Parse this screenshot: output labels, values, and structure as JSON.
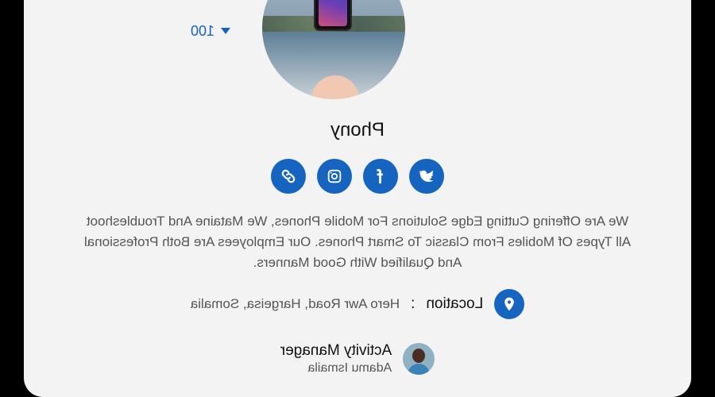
{
  "profile": {
    "score": "100",
    "name": "Phony",
    "description": "We Are Offering Cutting Edge Solutions For Mobile Phones, We Mataine And Troubleshoot All Types Of Mobiles From Classic To Smart Phones. Our Employees Are Both Professional And Qualified With Good Manners.",
    "location_label": "Location",
    "location_separator": ":",
    "location_value": "Hero Awr Road, Hargeisa, Somalia",
    "manager_role": "Activity Manager",
    "manager_name": "Adamu Ismaila"
  },
  "socials": [
    {
      "icon": "twitter-icon"
    },
    {
      "icon": "facebook-icon"
    },
    {
      "icon": "instagram-icon"
    },
    {
      "icon": "link-icon"
    }
  ],
  "colors": {
    "accent": "#1565c0",
    "card": "#f3f3f3",
    "frame": "#000000"
  }
}
